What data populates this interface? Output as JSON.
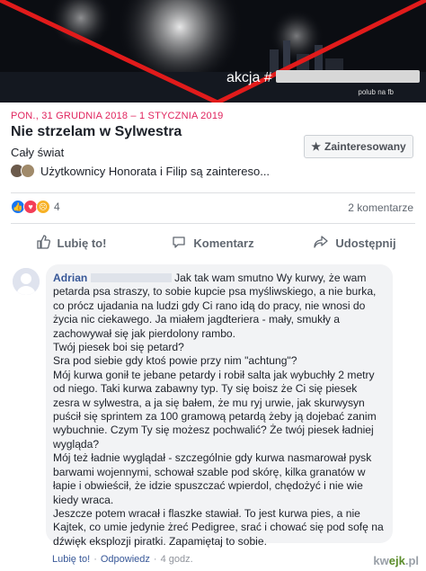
{
  "banner": {
    "text": "akcja #",
    "sub": "polub na fb"
  },
  "event": {
    "date": "PON., 31 GRUDNIA 2018 – 1 STYCZNIA 2019",
    "title": "Nie strzelam w Sylwestra",
    "subtitle": "Cały świat",
    "interested_label": "Zainteresowany",
    "interested_text": "Użytkownicy Honorata i Filip są zaintereso...",
    "reaction_count": "4",
    "comments_count": "2 komentarze"
  },
  "actions": {
    "like": "Lubię to!",
    "comment": "Komentarz",
    "share": "Udostępnij"
  },
  "comment": {
    "author": "Adrian",
    "lines": [
      "Jak tak wam smutno Wy kurwy, że wam petarda psa straszy, to sobie kupcie psa myśliwskiego, a nie burka, co prócz ujadania na ludzi gdy Ci rano idą do pracy, nie wnosi do życia nic ciekawego. Ja miałem jagdteriera - mały, smukły a zachowywał się jak pierdolony rambo.",
      "Twój piesek boi się petard?",
      "Sra pod siebie gdy ktoś powie przy nim \"achtung\"?",
      "Mój kurwa gonił te jebane petardy i robił salta jak wybuchły 2 metry od niego. Taki kurwa zabawny typ. Ty się boisz że Ci się piesek zesra w sylwestra, a ja się bałem, że mu ryj urwie, jak skurwysyn puścił się sprintem za 100 gramową petardą żeby ją dojebać zanim wybuchnie. Czym Ty się możesz pochwalić? Że twój piesek ładniej wygląda?",
      "Mój też ładnie wyglądał - szczególnie gdy kurwa nasmarował pysk barwami wojennymi, schował szable pod skórę, kilka granatów w łapie i obwieścił, że idzie spuszczać wpierdol, chędożyć i nie wie kiedy wraca.",
      "Jeszcze potem wracał i flaszke stawiał. To jest kurwa pies, a nie Kajtek, co umie jedynie żreć Pedigree, srać i chować się pod sofę na dźwięk eksplozji piratki. Zapamiętaj to sobie."
    ],
    "like_link": "Lubię to!",
    "reply_link": "Odpowiedz",
    "time": "4 godz."
  },
  "watermark": {
    "prefix": "kw",
    "brand": "ejk",
    "suffix": ".pl"
  },
  "colors": {
    "date_red": "#e0245e",
    "link_blue": "#385898",
    "cross_red": "#e11b1b"
  }
}
